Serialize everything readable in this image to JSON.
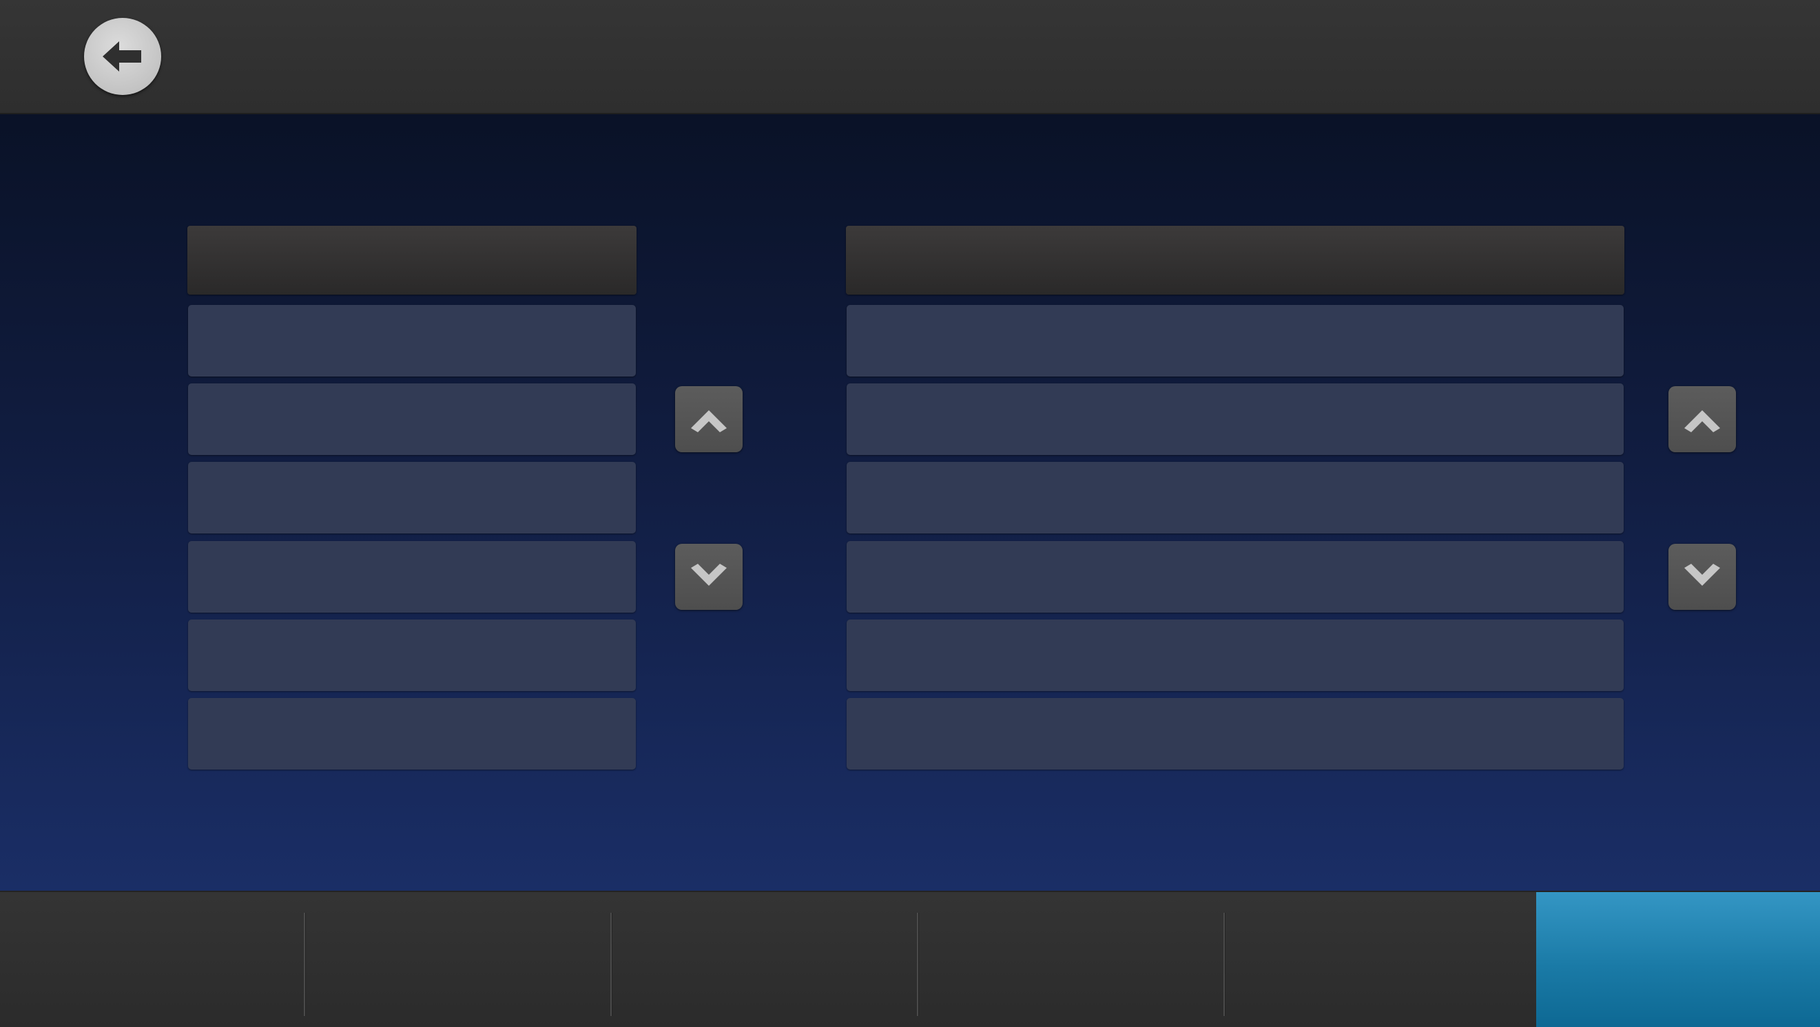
{
  "header": {
    "title": "",
    "back_icon": "arrow-left-icon"
  },
  "left_list": {
    "header_label": "",
    "rows": [
      {
        "label": ""
      },
      {
        "label": ""
      },
      {
        "label": ""
      },
      {
        "label": ""
      },
      {
        "label": ""
      },
      {
        "label": ""
      }
    ],
    "scroll_up_icon": "chevron-up-icon",
    "scroll_down_icon": "chevron-down-icon"
  },
  "right_list": {
    "header_label": "",
    "rows": [
      {
        "label": ""
      },
      {
        "label": ""
      },
      {
        "label": ""
      },
      {
        "label": ""
      },
      {
        "label": ""
      },
      {
        "label": ""
      }
    ],
    "scroll_up_icon": "chevron-up-icon",
    "scroll_down_icon": "chevron-down-icon"
  },
  "footer": {
    "tabs": [
      {
        "label": ""
      },
      {
        "label": ""
      },
      {
        "label": ""
      },
      {
        "label": ""
      },
      {
        "label": ""
      },
      {
        "label": ""
      }
    ],
    "active_tab_index": 5
  },
  "colors": {
    "accent": "#1f86b4",
    "row_background": "#323b55",
    "header_bar": "#333333"
  }
}
